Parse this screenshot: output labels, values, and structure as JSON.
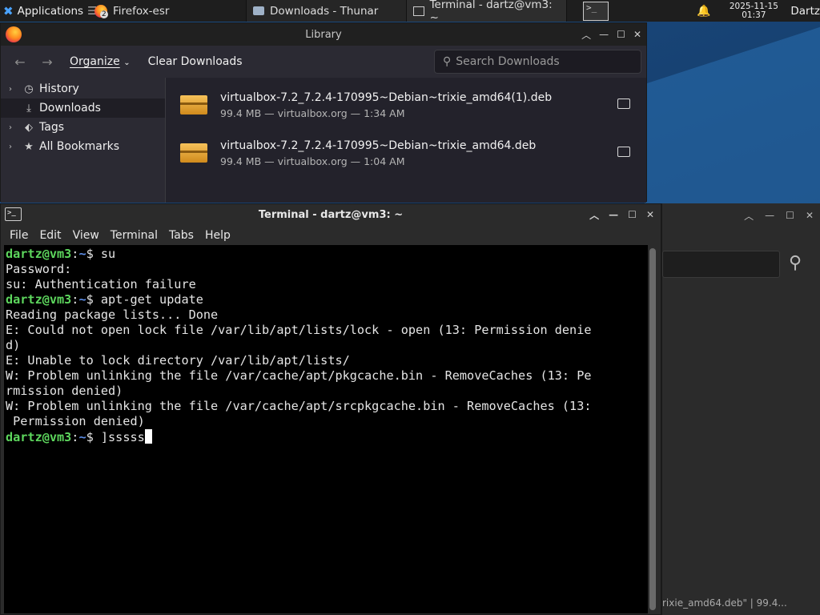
{
  "panel": {
    "applications_label": "Applications",
    "tasks": [
      {
        "label": "Firefox-esr",
        "badge": "2"
      },
      {
        "label": "Downloads - Thunar"
      },
      {
        "label": "Terminal - dartz@vm3: ~"
      }
    ],
    "clock_date": "2025-11-15",
    "clock_time": "01:37",
    "user": "Dartz"
  },
  "library": {
    "title": "Library",
    "organize_label": "Organize",
    "clear_label": "Clear Downloads",
    "search_placeholder": "Search Downloads",
    "sidebar": [
      {
        "label": "History",
        "icon": "clock-icon"
      },
      {
        "label": "Downloads",
        "icon": "download-icon"
      },
      {
        "label": "Tags",
        "icon": "tag-icon"
      },
      {
        "label": "All Bookmarks",
        "icon": "star-icon"
      }
    ],
    "downloads": [
      {
        "name": "virtualbox-7.2_7.2.4-170995~Debian~trixie_amd64(1).deb",
        "meta": "99.4 MB — virtualbox.org — 1:34 AM"
      },
      {
        "name": "virtualbox-7.2_7.2.4-170995~Debian~trixie_amd64.deb",
        "meta": "99.4 MB — virtualbox.org — 1:04 AM"
      }
    ]
  },
  "thunar": {
    "status": "rixie_amd64.deb\"  |  99.4..."
  },
  "terminal": {
    "title": "Terminal - dartz@vm3: ~",
    "menu": [
      "File",
      "Edit",
      "View",
      "Terminal",
      "Tabs",
      "Help"
    ],
    "prompt_user": "dartz@vm3",
    "prompt_path": "~",
    "lines": [
      {
        "prompt": true,
        "text": "$ su"
      },
      {
        "prompt": false,
        "text": "Password:"
      },
      {
        "prompt": false,
        "text": "su: Authentication failure"
      },
      {
        "prompt": true,
        "text": "$ apt-get update"
      },
      {
        "prompt": false,
        "text": "Reading package lists... Done"
      },
      {
        "prompt": false,
        "text": "E: Could not open lock file /var/lib/apt/lists/lock - open (13: Permission denie"
      },
      {
        "prompt": false,
        "text": "d)"
      },
      {
        "prompt": false,
        "text": "E: Unable to lock directory /var/lib/apt/lists/"
      },
      {
        "prompt": false,
        "text": "W: Problem unlinking the file /var/cache/apt/pkgcache.bin - RemoveCaches (13: Pe"
      },
      {
        "prompt": false,
        "text": "rmission denied)"
      },
      {
        "prompt": false,
        "text": "W: Problem unlinking the file /var/cache/apt/srcpkgcache.bin - RemoveCaches (13:"
      },
      {
        "prompt": false,
        "text": " Permission denied)"
      },
      {
        "prompt": true,
        "text": "$ ]sssss",
        "cursor": true
      }
    ]
  }
}
